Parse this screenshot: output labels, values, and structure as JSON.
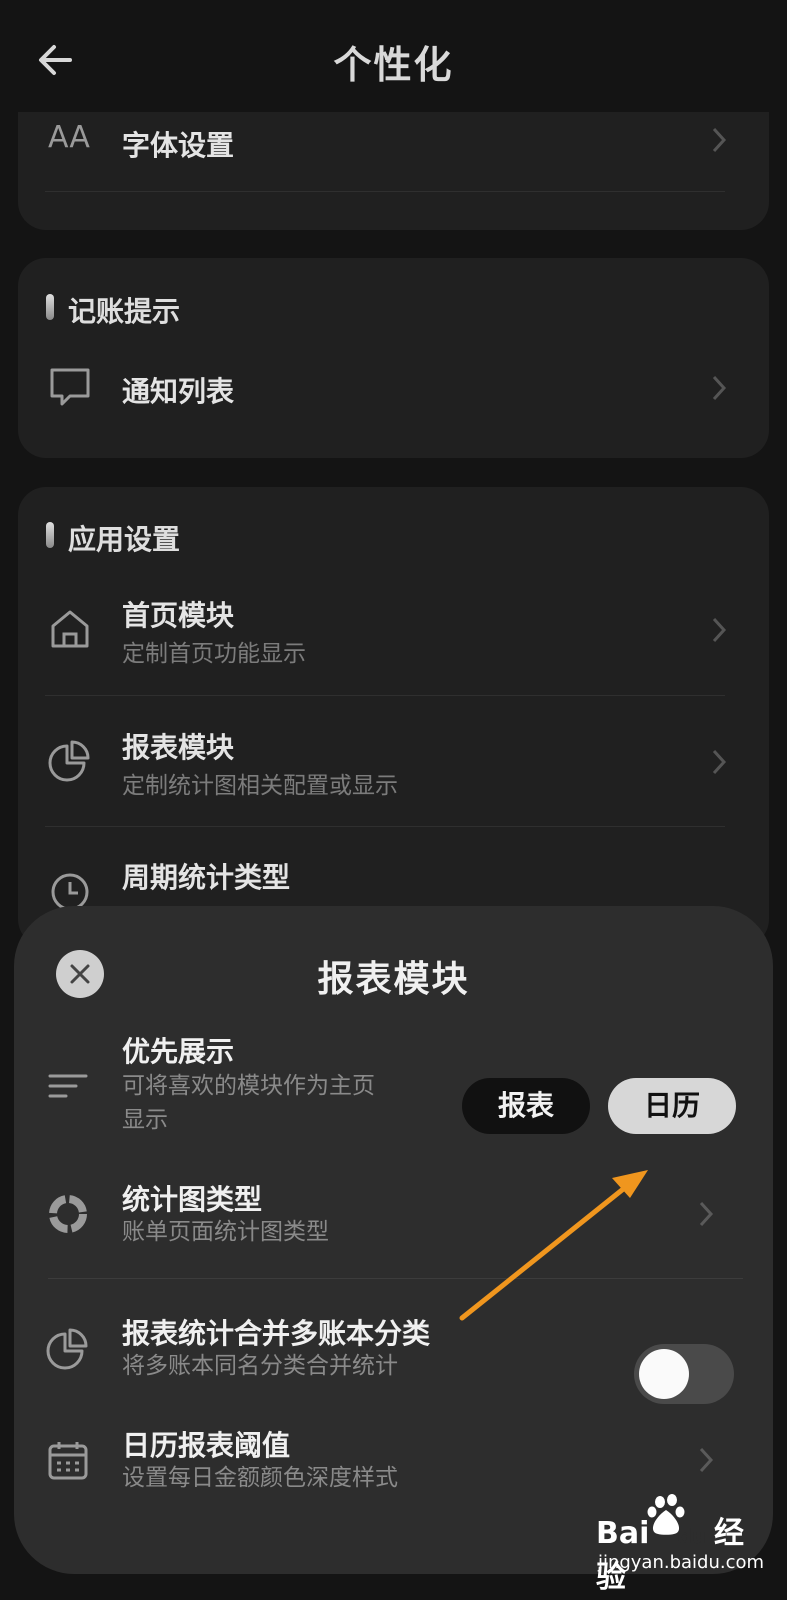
{
  "header": {
    "title": "个性化"
  },
  "font_row": {
    "title": "字体设置",
    "icon_text": "AA"
  },
  "reminder_section": {
    "title": "记账提示",
    "items": [
      {
        "title": "通知列表"
      }
    ]
  },
  "app_section": {
    "title": "应用设置",
    "items": [
      {
        "title": "首页模块",
        "subtitle": "定制首页功能显示"
      },
      {
        "title": "报表模块",
        "subtitle": "定制统计图相关配置或显示"
      },
      {
        "title": "周期统计类型"
      }
    ]
  },
  "sheet": {
    "title": "报表模块",
    "priority": {
      "title": "优先展示",
      "subtitle_line1": "可将喜欢的模块作为主页",
      "subtitle_line2": "显示",
      "option_report": "报表",
      "option_calendar": "日历",
      "selected": "日历"
    },
    "chart_type": {
      "title": "统计图类型",
      "subtitle": "账单页面统计图类型"
    },
    "merge": {
      "title": "报表统计合并多账本分类",
      "subtitle": "将多账本同名分类合并统计",
      "enabled": false
    },
    "threshold": {
      "title": "日历报表阈值",
      "subtitle": "设置每日金额颜色深度样式"
    }
  },
  "watermark": {
    "brand_a": "Bai",
    "brand_b": "du",
    "brand_c": "经验",
    "url": "jingyan.baidu.com"
  },
  "colors": {
    "background": "#141414",
    "card": "#202020",
    "sheet": "#2d2d2d",
    "arrow": "#f0961e"
  }
}
